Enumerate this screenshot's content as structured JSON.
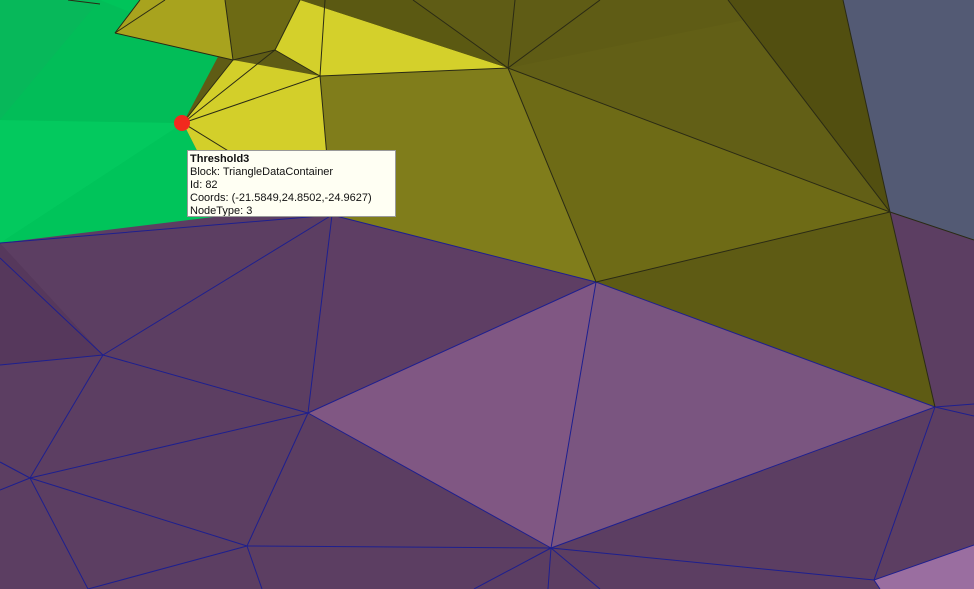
{
  "tooltip": {
    "title": "Threshold3",
    "block_label": "Block",
    "block_value": "TriangleDataContainer",
    "id_label": "Id",
    "id_value": "82",
    "coords_label": "Coords",
    "coords_value": "(-21.5849,24.8502,-24.9627)",
    "nodetype_label": "NodeType",
    "nodetype_value": "3"
  },
  "colors": {
    "green_region": "#00c45a",
    "yellow_region": "#d3cf2a",
    "olive_region": "#7d7a17",
    "dark_olive_region": "#5f5c15",
    "purple_region": "#5c3e62",
    "light_purple_region": "#805783",
    "slate_region": "#535a74",
    "purple_edges": "#1d1f8f",
    "yellow_edges": "#2a2a14",
    "picked_point": "#f2291e",
    "tooltip_bg": "#fffff3"
  }
}
